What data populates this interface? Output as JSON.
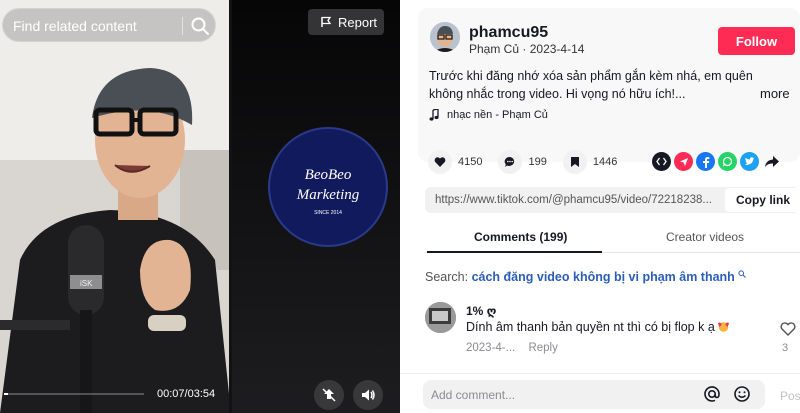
{
  "video": {
    "search_placeholder": "Find related content",
    "report_label": "Report",
    "time_display": "00:07/03:54",
    "progress_fraction": 0.03,
    "logo_lines": [
      "BeoBeo",
      "Marketing",
      "SINCE 2014"
    ],
    "mic_brand": "iSK"
  },
  "author": {
    "username": "phamcu95",
    "display_name": "Phạm Củ",
    "separator": "·",
    "date": "2023-4-14",
    "follow_label": "Follow"
  },
  "post": {
    "description": "Trước khi đăng nhớ xóa sản phẩm gắn kèm nhá, em quên không nhắc trong video. Hi vọng nó hữu ích!...",
    "more_label": "more",
    "music": "nhạc nền - Phạm Củ"
  },
  "stats": {
    "likes": "4150",
    "comments": "199",
    "saves": "1446"
  },
  "share": {
    "icons": [
      "embed-icon",
      "send-icon",
      "facebook-icon",
      "whatsapp-icon",
      "twitter-icon",
      "share-arrow-icon"
    ],
    "colors": {
      "send": "#fe2c55",
      "facebook": "#1877f2",
      "whatsapp": "#25d366",
      "twitter": "#1da1f2",
      "embed": "#161823"
    }
  },
  "link": {
    "url": "https://www.tiktok.com/@phamcu95/video/72218238...",
    "copy_label": "Copy link"
  },
  "tabs": {
    "comments": "Comments (199)",
    "creator": "Creator videos"
  },
  "search_suggest": {
    "label": "Search:",
    "term": "cách đăng video không bị vi phạm âm thanh"
  },
  "comment": {
    "user": "1% ღ",
    "text": "Dính âm thanh bản quyền nt thì có bị flop k ạ",
    "date": "2023-4-...",
    "reply_label": "Reply",
    "likes": "3"
  },
  "add_comment": {
    "placeholder": "Add comment...",
    "post_label": "Post"
  },
  "theme": {
    "accent": "#fe2c55",
    "link_blue": "#2b5db9"
  }
}
